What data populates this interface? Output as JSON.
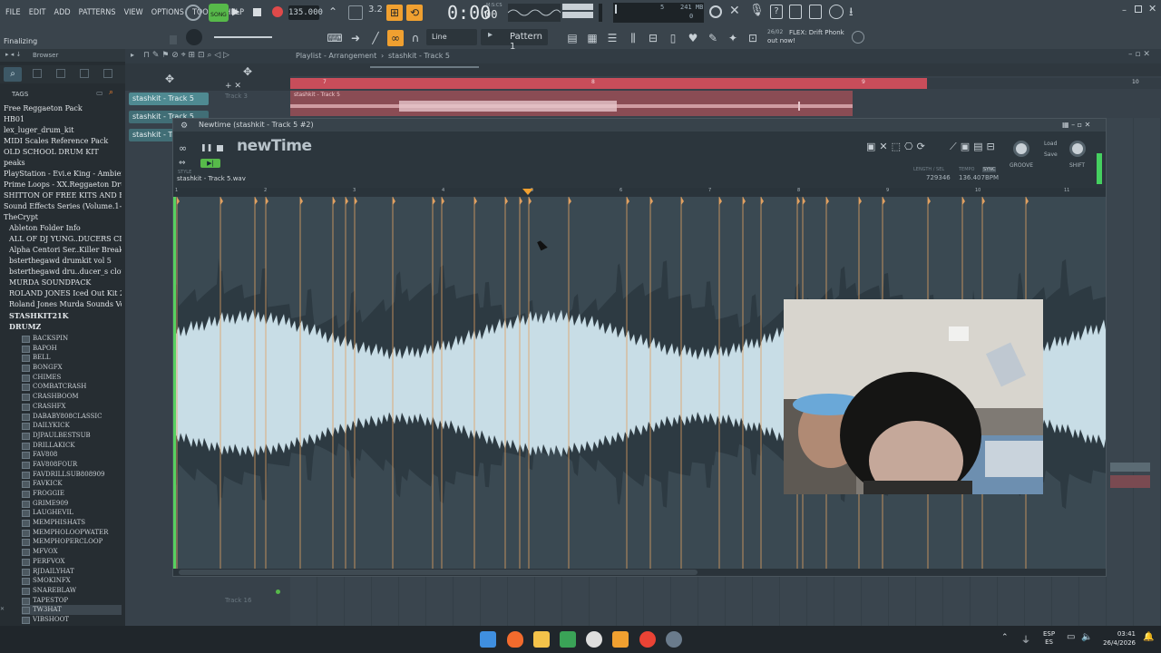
{
  "menu": [
    "FILE",
    "EDIT",
    "ADD",
    "PATTERNS",
    "VIEW",
    "OPTIONS",
    "TOOLS",
    "HELP"
  ],
  "transport": {
    "song_label": "SONG",
    "tempo": "135.000",
    "time": "0:00",
    "time_small": "00",
    "time_unit": "M:S:CS",
    "memory": "241 MB",
    "voices": "5",
    "cpu": "0"
  },
  "status": {
    "hint": "Finalizing",
    "snap": "Line",
    "pattern": "Pattern 1",
    "news_date": "26/02",
    "news_text": "FLEX: Drift Phonk out now!"
  },
  "browser": {
    "title": "Browser",
    "tags_label": "TAGS",
    "tags": [
      "Free Reggaeton Pack",
      "HB01",
      "lex_luger_drum_kit",
      "MIDI Scales Reference Pack",
      "OLD SCHOOL DRUM KIT",
      "peaks",
      "PlayStation - Evi.e King - Ambience",
      "Prime Loops - XX.Reggaeton Drums",
      "SHITTON OF FREE KITS AND FLPS",
      "Sound Effects Series (Volume.1-10)",
      "TheCrypt",
      "Ableton Folder Info",
      "ALL OF DJ YUNG..DUCERS CLOUD]",
      "Alpha Centori Ser..Killer Breaks 3",
      "bsterthegawd drumkit vol 5",
      "bsterthegawd dru..ducer_s cloud]",
      "MURDA SOUNDPACK",
      "ROLAND JONES Iced Out Kit 2",
      "Roland Jones Murda Sounds Vol.5",
      "STASHKIT21K",
      "DRUMZ"
    ],
    "folders": [
      "BACKSPIN",
      "BAPOH",
      "BELL",
      "BONGFX",
      "CHIMES",
      "COMBATCRASH",
      "CRASHBOOM",
      "CRASHFX",
      "DABABY808CLASSIC",
      "DAILYKICK",
      "DJPAULBESTSUB",
      "DRILLAKICK",
      "FAV808",
      "FAV808FOUR",
      "FAVDRILLSUB808909",
      "FAVKICK",
      "FROGGIE",
      "GRIME909",
      "LAUGHEVIL",
      "MEMPHISHATS",
      "MEMPHOLOOPWATER",
      "MEMPHOPERCLOOP",
      "MFVOX",
      "PERFVOX",
      "RJDAILYHAT",
      "SMOKINFX",
      "SNAREBLAW",
      "TAPESTOP",
      "TW3HAT",
      "VIBSHOOT"
    ],
    "selected_folder": "TW3HAT"
  },
  "playlist": {
    "breadcrumb": "Playlist - Arrangement",
    "breadcrumb_track": "stashkit - Track 5",
    "track_buttons": [
      "stashkit - Track 5",
      "stashkit - Track 5",
      "stashkit - Track 5"
    ],
    "clip_label": "stashkit - Track 5",
    "track3": "Track 3",
    "track16": "Track 16",
    "ruler_marks": [
      "7",
      "8",
      "9",
      "10"
    ]
  },
  "newtime": {
    "title": "Newtime (stashkit - Track 5 #2)",
    "logo": "newTime",
    "file": "stashkit - Track 5.wav",
    "style_label": "STYLE",
    "length_label": "LENGTH / SEL",
    "length_value": "729346",
    "tempo_label": "TEMPO",
    "tempo_value": "136.407BPM",
    "sync_label": "SYNC",
    "groove_label": "GROOVE",
    "shift_label": "SHIFT",
    "load_label": "Load",
    "save_label": "Save",
    "ruler": [
      "1",
      "2",
      "3",
      "4",
      "5",
      "6",
      "7",
      "8",
      "9",
      "10",
      "11"
    ],
    "slice_progress": 0.47
  },
  "taskbar": {
    "lang_top": "ESP",
    "lang_bottom": "ES",
    "time": "03:41",
    "date": "26/4/2026"
  },
  "colors": {
    "accent_orange": "#f0a030",
    "accent_green": "#57b94a",
    "slice_marker": "#e0a060",
    "waveform": "#c8dde6",
    "clip_red": "#c84d5a"
  }
}
